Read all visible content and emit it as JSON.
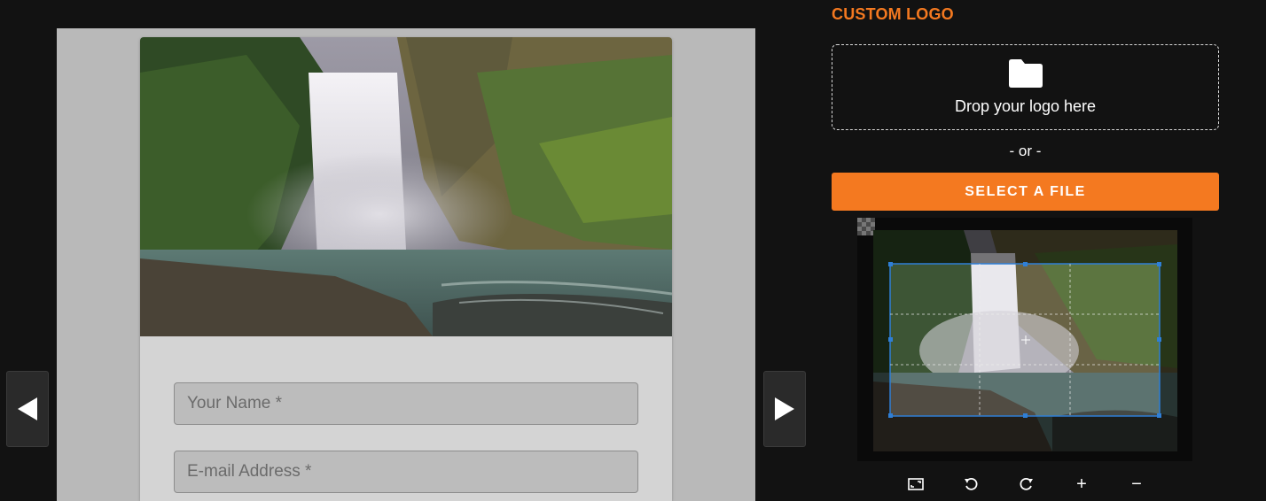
{
  "form": {
    "name_placeholder": "Your Name *",
    "email_placeholder": "E-mail Address *"
  },
  "nav": {
    "prev_icon": "triangle-left-icon",
    "next_icon": "triangle-right-icon"
  },
  "panel": {
    "heading": "CUSTOM LOGO",
    "drop_text": "Drop your logo here",
    "or_text": "- or -",
    "select_button": "SELECT A FILE"
  },
  "tools": [
    {
      "icon": "aspect-ratio-icon"
    },
    {
      "icon": "rotate-left-icon"
    },
    {
      "icon": "rotate-right-icon"
    },
    {
      "icon": "zoom-in-icon",
      "label": "+"
    },
    {
      "icon": "zoom-out-icon",
      "label": "−"
    }
  ],
  "colors": {
    "accent": "#f47920",
    "background": "#121212",
    "crop_box": "#2f7fd6"
  }
}
